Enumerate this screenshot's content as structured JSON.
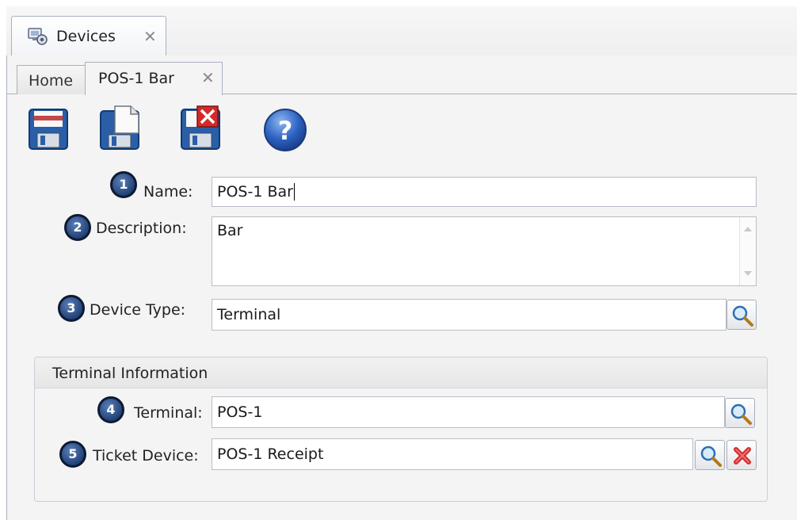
{
  "outer_tab": {
    "label": "Devices",
    "close": "✕",
    "icon": "devices-icon"
  },
  "inner_tabs": [
    {
      "label": "Home"
    },
    {
      "label": "POS-1 Bar",
      "close": "✕",
      "active": true
    }
  ],
  "toolbar": {
    "buttons": [
      {
        "name": "save-icon"
      },
      {
        "name": "save-copy-icon"
      },
      {
        "name": "delete-icon"
      },
      {
        "name": "help-icon",
        "glyph": "?"
      }
    ]
  },
  "form": {
    "name": {
      "badge": "1",
      "label": "Name:",
      "value": "POS-1 Bar"
    },
    "description": {
      "badge": "2",
      "label": "Description:",
      "value": "Bar"
    },
    "device_type": {
      "badge": "3",
      "label": "Device Type:",
      "value": "Terminal"
    }
  },
  "terminal_info": {
    "title": "Terminal Information",
    "terminal": {
      "badge": "4",
      "label": "Terminal:",
      "value": "POS-1"
    },
    "ticket_device": {
      "badge": "5",
      "label": "Ticket Device:",
      "value": "POS-1 Receipt"
    }
  },
  "colors": {
    "badge": "#2a4a80",
    "border": "#a9b1bd",
    "panel_bg": "#f4f4f4",
    "delete_red": "#d42a2a"
  }
}
